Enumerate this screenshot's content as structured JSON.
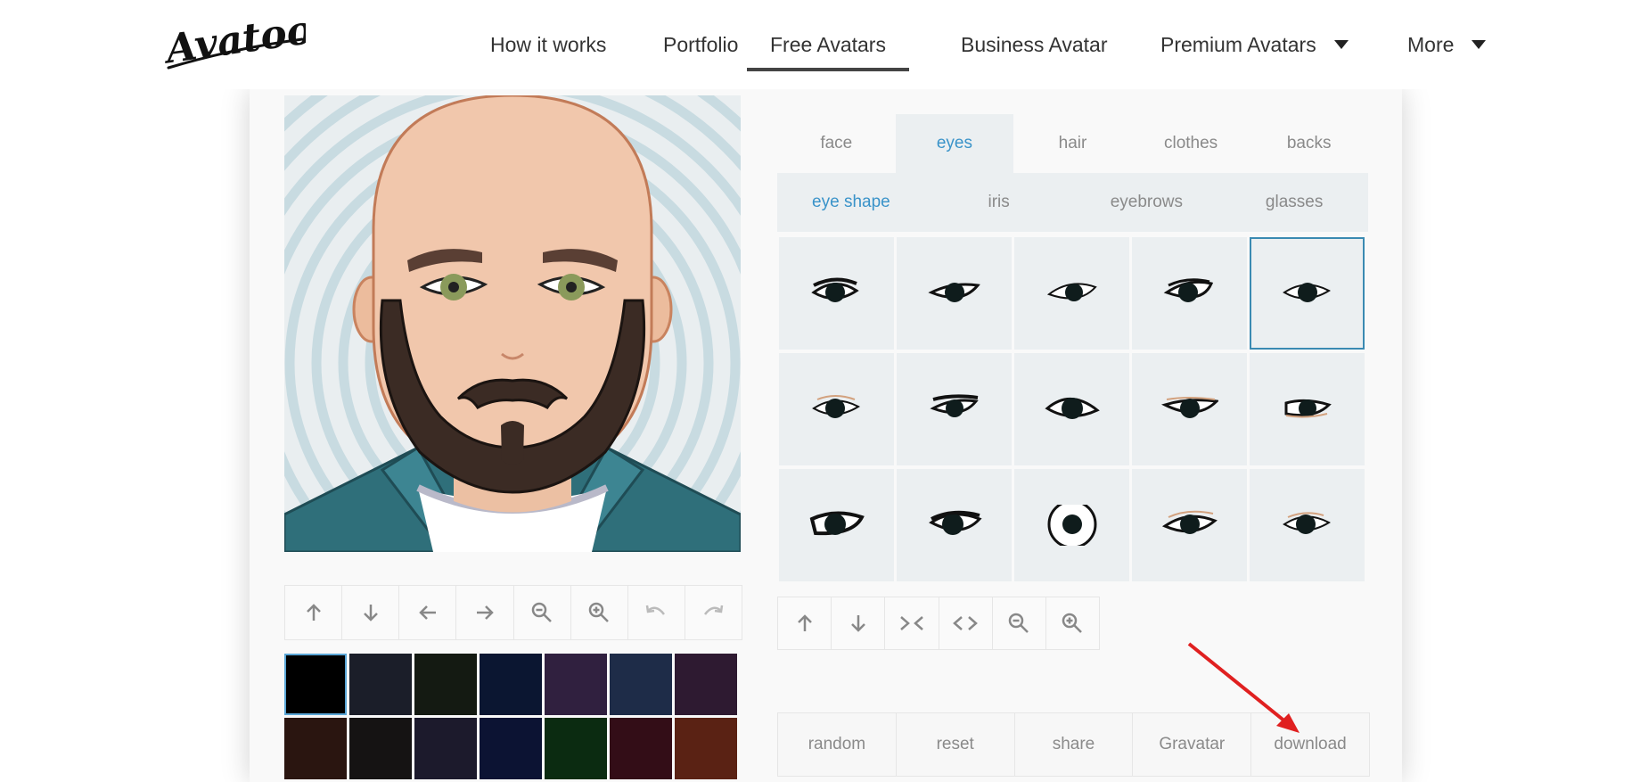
{
  "brand": {
    "name": "Avatoon"
  },
  "nav": [
    {
      "label": "How it works",
      "caret": false,
      "active": false
    },
    {
      "label": "Portfolio",
      "caret": false,
      "active": false
    },
    {
      "label": "Free Avatars",
      "caret": false,
      "active": true
    },
    {
      "label": "Business Avatar",
      "caret": false,
      "active": false
    },
    {
      "label": "Premium Avatars",
      "caret": true,
      "active": false
    },
    {
      "label": "More",
      "caret": true,
      "active": false
    }
  ],
  "tabs": [
    {
      "label": "face",
      "active": false
    },
    {
      "label": "eyes",
      "active": true
    },
    {
      "label": "hair",
      "active": false
    },
    {
      "label": "clothes",
      "active": false
    },
    {
      "label": "backs",
      "active": false
    }
  ],
  "subtabs": [
    {
      "label": "eye shape",
      "active": true
    },
    {
      "label": "iris",
      "active": false
    },
    {
      "label": "eyebrows",
      "active": false
    },
    {
      "label": "glasses",
      "active": false
    }
  ],
  "eye_options": {
    "count": 15,
    "selected_index": 4
  },
  "avatar_controls": [
    "arrow-up-icon",
    "arrow-down-icon",
    "arrow-left-icon",
    "arrow-right-icon",
    "zoom-out-icon",
    "zoom-in-icon",
    "undo-icon",
    "redo-icon"
  ],
  "part_controls": [
    "arrow-up-icon",
    "arrow-down-icon",
    "narrow-icon",
    "widen-icon",
    "zoom-out-icon",
    "zoom-in-icon"
  ],
  "colors": {
    "accent": "#3a93c9",
    "selected_border": "#3a8ab2",
    "panel": "#ebeff1",
    "annotation_arrow": "#e02020",
    "skin": "#f1c7ac",
    "beard": "#3b2b24",
    "jacket": "#2f6f7a",
    "iris": "#8a9a5b"
  },
  "swatches": {
    "selected_index": 0,
    "colors": [
      "#000000",
      "#1b1e29",
      "#141a12",
      "#0b1631",
      "#30203f",
      "#1e2c48",
      "#2e1a31",
      "#2a1510",
      "#151313",
      "#1c1a2c",
      "#0c1333",
      "#0b2b11",
      "#330d17",
      "#5a2214"
    ]
  },
  "actions": [
    {
      "label": "random"
    },
    {
      "label": "reset"
    },
    {
      "label": "share"
    },
    {
      "label": "Gravatar"
    },
    {
      "label": "download"
    }
  ]
}
